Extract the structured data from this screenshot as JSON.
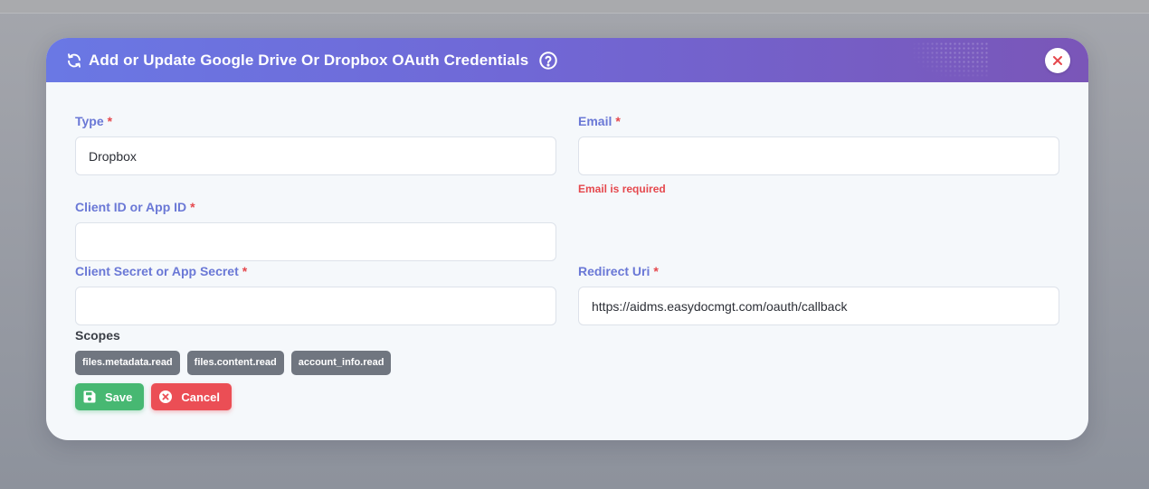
{
  "modal": {
    "title": "Add or Update Google Drive Or Dropbox OAuth Credentials",
    "icons": {
      "title": "refresh-icon",
      "help": "help-circle-icon",
      "close": "close-icon"
    }
  },
  "form": {
    "type": {
      "label": "Type",
      "required_mark": "*",
      "value": "Dropbox"
    },
    "email": {
      "label": "Email",
      "required_mark": "*",
      "value": "",
      "error": "Email is required"
    },
    "client_id": {
      "label": "Client ID or App ID",
      "required_mark": "*",
      "value": ""
    },
    "client_secret": {
      "label": "Client Secret or App Secret",
      "required_mark": "*",
      "value": ""
    },
    "redirect_uri": {
      "label": "Redirect Uri",
      "required_mark": "*",
      "value": "https://aidms.easydocmgt.com/oauth/callback"
    }
  },
  "scopes": {
    "label": "Scopes",
    "items": [
      "files.metadata.read",
      "files.content.read",
      "account_info.read"
    ]
  },
  "actions": {
    "save_label": "Save",
    "cancel_label": "Cancel",
    "save_icon": "floppy-disk-icon",
    "cancel_icon": "close-circle-icon"
  },
  "colors": {
    "header_gradient_start": "#6a78e4",
    "header_gradient_end": "#7a56b8",
    "label": "#6a78d6",
    "required": "#e5484d",
    "save": "#47b872",
    "cancel": "#eb4e55",
    "badge": "#707680"
  }
}
